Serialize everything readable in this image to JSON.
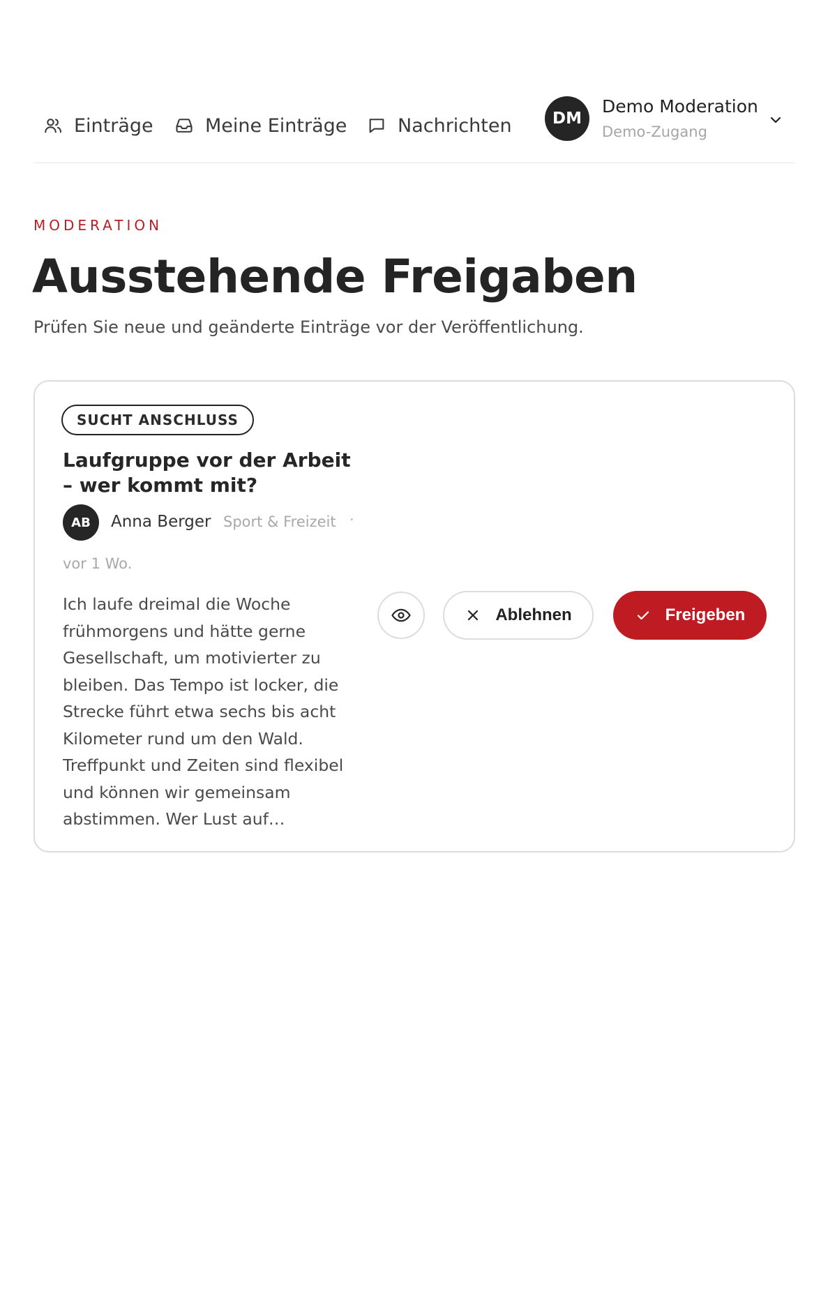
{
  "nav": {
    "items": [
      {
        "label": "Einträge",
        "icon": "users-icon"
      },
      {
        "label": "Meine Einträge",
        "icon": "inbox-icon"
      },
      {
        "label": "Nachrichten",
        "icon": "message-icon"
      }
    ],
    "user": {
      "initials": "DM",
      "name": "Demo Moderation",
      "role": "Demo-Zugang",
      "menu_icon": "chevron-down-icon"
    }
  },
  "header": {
    "eyebrow": "MODERATION",
    "title": "Ausstehende Freigaben",
    "subtitle": "Prüfen Sie neue und geänderte Einträge vor der Veröffentlichung."
  },
  "pending": [
    {
      "badge": "SUCHT ANSCHLUSS",
      "title": "Laufgruppe vor der Arbeit – wer kommt mit?",
      "author_initials": "AB",
      "author_name": "Anna Berger",
      "category": "Sport & Freizeit",
      "separator": "·",
      "time": "vor 1 Wo.",
      "excerpt": "Ich laufe dreimal die Woche frühmorgens und hätte gerne Gesellschaft, um motivierter zu bleiben. Das Tempo ist locker, die Strecke führt etwa sechs bis acht Kilometer rund um den Wald. Treffpunkt und Zeiten sind flexibel und können wir gemeinsam abstimmen. Wer Lust auf…",
      "actions": {
        "preview_icon": "eye-icon",
        "reject_label": "Ablehnen",
        "reject_icon": "close-icon",
        "approve_label": "Freigeben",
        "approve_icon": "check-icon"
      }
    }
  ],
  "colors": {
    "accent": "#be1b22",
    "eyebrow": "#b52025",
    "avatar_bg": "#252525",
    "border": "#dcdcdc"
  }
}
